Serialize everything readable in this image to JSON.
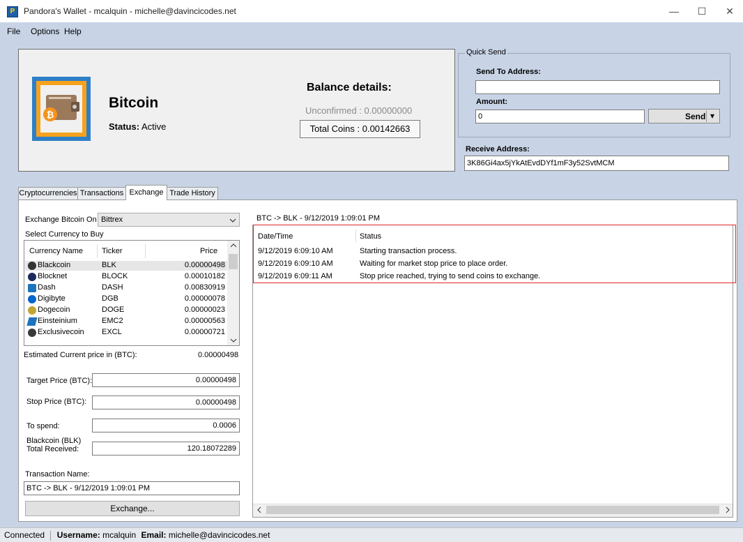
{
  "window": {
    "title": "Pandora's Wallet - mcalquin - michelle@davincicodes.net",
    "app_icon": "P",
    "minimize_glyph": "—",
    "maximize_glyph": "☐",
    "close_glyph": "✕"
  },
  "menu": [
    "File",
    "Options",
    "Help"
  ],
  "coin": {
    "name": "Bitcoin",
    "status_label": "Status:",
    "status_value": "Active",
    "balance_title": "Balance details:",
    "unconfirmed": "Unconfirmed : 0.00000000",
    "total": "Total Coins : 0.00142663"
  },
  "quick_send": {
    "legend": "Quick Send",
    "send_to_label": "Send To Address:",
    "send_to_value": "",
    "amount_label": "Amount:",
    "amount_value": "0",
    "send_button": "Send",
    "send_dropdown_glyph": "▾",
    "receive_label": "Receive Address:",
    "receive_value": "3K86Gi4ax5jYkAtEvdDYf1mF3y52SvtMCM"
  },
  "tabs": [
    "Cryptocurrencies",
    "Transactions",
    "Exchange",
    "Trade History"
  ],
  "active_tab": "Exchange",
  "exchange": {
    "exchange_on_label": "Exchange Bitcoin On",
    "exchange_value": "Bittrex",
    "select_label": "Select Currency to Buy",
    "columns": [
      "Currency Name",
      "Ticker",
      "Price"
    ],
    "currencies": [
      {
        "name": "Blackcoin",
        "ticker": "BLK",
        "price": "0.00000498",
        "icon_color": "#333333"
      },
      {
        "name": "Blocknet",
        "ticker": "BLOCK",
        "price": "0.00010182",
        "icon_color": "#1a2a5c"
      },
      {
        "name": "Dash",
        "ticker": "DASH",
        "price": "0.00830919",
        "icon_color": "#1c75bc"
      },
      {
        "name": "Digibyte",
        "ticker": "DGB",
        "price": "0.00000078",
        "icon_color": "#0066cc"
      },
      {
        "name": "Dogecoin",
        "ticker": "DOGE",
        "price": "0.00000023",
        "icon_color": "#c2a633"
      },
      {
        "name": "Einsteinium",
        "ticker": "EMC2",
        "price": "0.00000563",
        "icon_color": "#1e73be"
      },
      {
        "name": "Exclusivecoin",
        "ticker": "EXCL",
        "price": "0.00000721",
        "icon_color": "#3a3a3a"
      }
    ],
    "estimated_label": "Estimated Current price in (BTC):",
    "estimated_value": "0.00000498",
    "target_label": "Target Price (BTC):",
    "target_value": "0.00000498",
    "stop_label": "Stop Price (BTC):",
    "stop_value": "0.00000498",
    "spend_label": "To spend:",
    "spend_value": "0.0006",
    "received_label_1": "Blackcoin (BLK)",
    "received_label_2": "Total Received:",
    "received_value": "120.18072289",
    "txname_label": "Transaction Name:",
    "txname_value": "BTC -> BLK - 9/12/2019 1:09:01 PM",
    "exchange_button": "Exchange..."
  },
  "log": {
    "title": "BTC -> BLK - 9/12/2019 1:09:01 PM",
    "columns": [
      "Date/Time",
      "Status"
    ],
    "rows": [
      {
        "time": "9/12/2019 6:09:10 AM",
        "status": "Starting transaction process."
      },
      {
        "time": "9/12/2019 6:09:10 AM",
        "status": "Waiting for market stop price to place order."
      },
      {
        "time": "9/12/2019 6:09:11 AM",
        "status": "Stop price reached, trying to send coins to exchange."
      }
    ]
  },
  "statusbar": {
    "connection": "Connected",
    "username_label": "Username:",
    "username": "mcalquin",
    "email_label": "Email:",
    "email": "michelle@davincicodes.net"
  }
}
